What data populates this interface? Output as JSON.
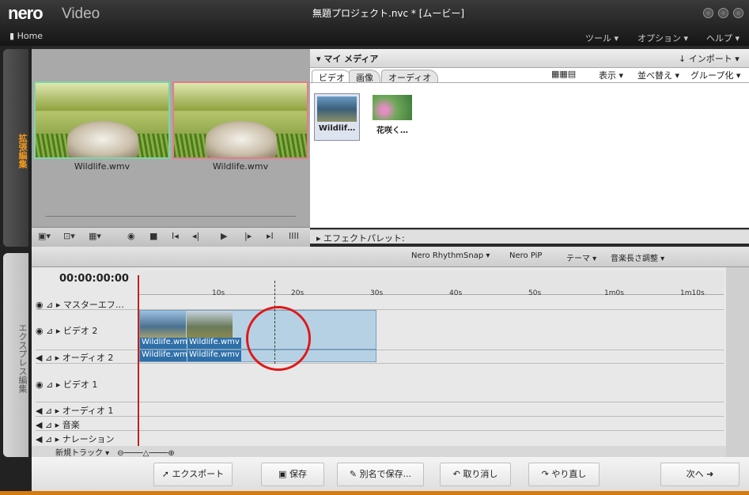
{
  "app": {
    "logo": "nero",
    "product": "Video",
    "window_title": "無題プロジェクト.nvc * [ムービー]",
    "home": "Home"
  },
  "menu": [
    "ツール ▾",
    "オプション ▾",
    "ヘルプ ▾"
  ],
  "left_tabs": {
    "advanced": "拡張編集",
    "express": "エクスプレス編集"
  },
  "preview": {
    "labels": [
      "Wildlife.wmv",
      "Wildlife.wmv"
    ]
  },
  "playback_buttons": [
    "▣▾",
    "⊡▾",
    "▦▾",
    "◉",
    "■",
    "I◂",
    "◂|",
    "▶",
    "|▸",
    "▸I",
    "IIII"
  ],
  "media": {
    "title": "▾ マイ メディア",
    "import": "↓ インポート ▾",
    "tabs": [
      "ビデオ",
      "画像",
      "オーディオ"
    ],
    "view": "表示 ▾",
    "sort": "並べ替え ▾",
    "group": "グループ化 ▾",
    "items": [
      "Wildlif…",
      "花咲く…"
    ]
  },
  "effects": "▸ エフェクトパレット:",
  "timeline_toolbar": {
    "rhythm": "Nero RhythmSnap ▾",
    "pip": "Nero PiP",
    "theme": "テーマ ▾",
    "music": "音楽長さ調整 ▾"
  },
  "timecode": "00:00:00:00",
  "ruler": [
    "10s",
    "20s",
    "30s",
    "40s",
    "50s",
    "1m0s",
    "1m10s"
  ],
  "tracks": [
    "▸ マスターエフ…",
    "▸ ビデオ 2",
    "▸ オーディオ 2",
    "▸ ビデオ 1",
    "▸ オーディオ 1",
    "▸ 音楽",
    "▸ ナレーション"
  ],
  "clips": {
    "video": [
      "Wildlife.wm",
      "Wildlife.wmv"
    ],
    "audio": [
      "Wildlife.wm",
      "Wildlife.wmv"
    ]
  },
  "zoom": {
    "new_track": "新規トラック ▾"
  },
  "bottom": {
    "export": "エクスポート",
    "save": "保存",
    "save_as": "別名で保存...",
    "undo": "取り消し",
    "redo": "やり直し",
    "next": "次へ"
  }
}
